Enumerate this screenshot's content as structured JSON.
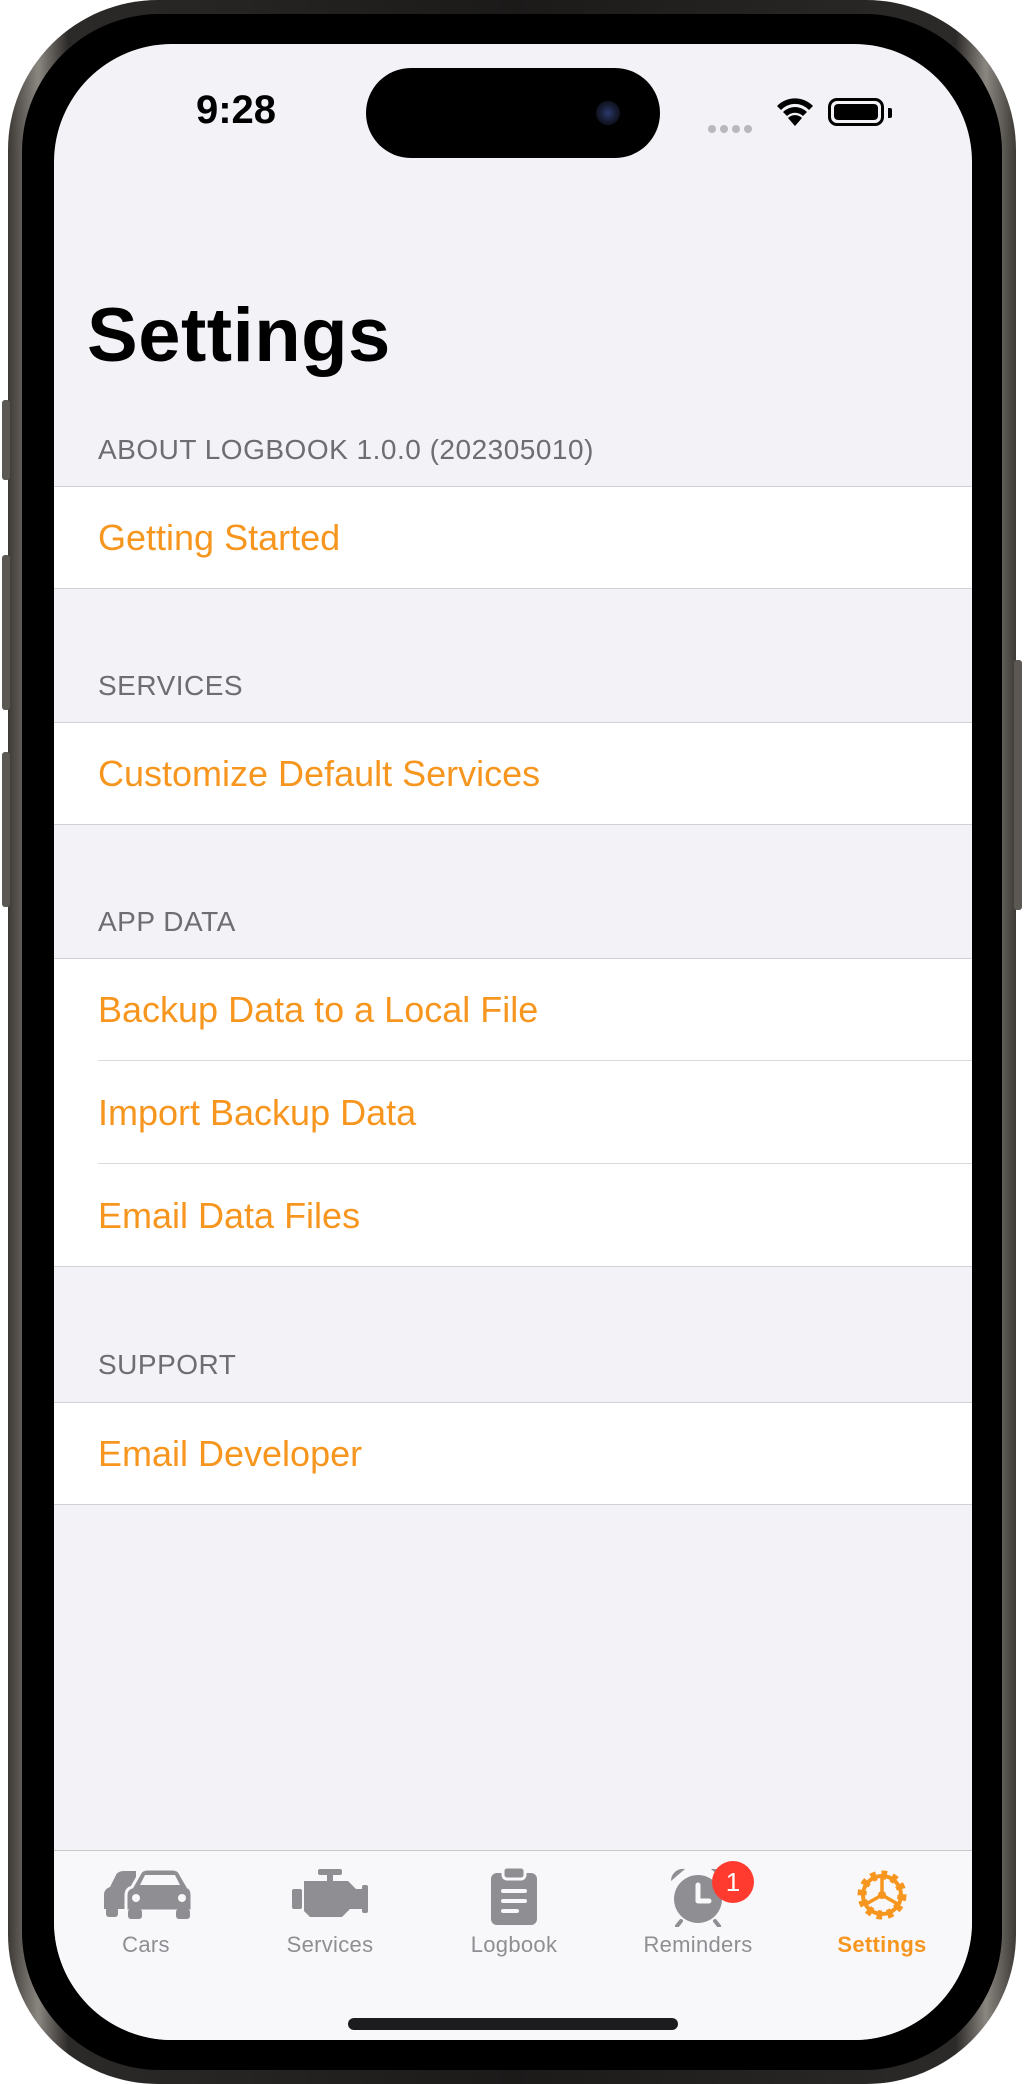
{
  "status_bar": {
    "time": "9:28"
  },
  "page": {
    "title": "Settings"
  },
  "sections": [
    {
      "header": "ABOUT LOGBOOK 1.0.0 (202305010)",
      "items": [
        {
          "label": "Getting Started"
        }
      ]
    },
    {
      "header": "SERVICES",
      "items": [
        {
          "label": "Customize Default Services"
        }
      ]
    },
    {
      "header": "APP DATA",
      "items": [
        {
          "label": "Backup Data to a Local File"
        },
        {
          "label": "Import Backup Data"
        },
        {
          "label": "Email Data Files"
        }
      ]
    },
    {
      "header": "SUPPORT",
      "items": [
        {
          "label": "Email Developer"
        }
      ]
    }
  ],
  "tabbar": {
    "tabs": [
      {
        "label": "Cars",
        "icon": "car-icon"
      },
      {
        "label": "Services",
        "icon": "engine-icon"
      },
      {
        "label": "Logbook",
        "icon": "clipboard-icon"
      },
      {
        "label": "Reminders",
        "icon": "alarm-clock-icon",
        "badge": "1"
      },
      {
        "label": "Settings",
        "icon": "gear-icon",
        "active": true
      }
    ]
  },
  "colors": {
    "accent": "#f7961e",
    "background": "#f2f2f7",
    "badge": "#ff3b30",
    "inactive": "#8e8e93"
  }
}
